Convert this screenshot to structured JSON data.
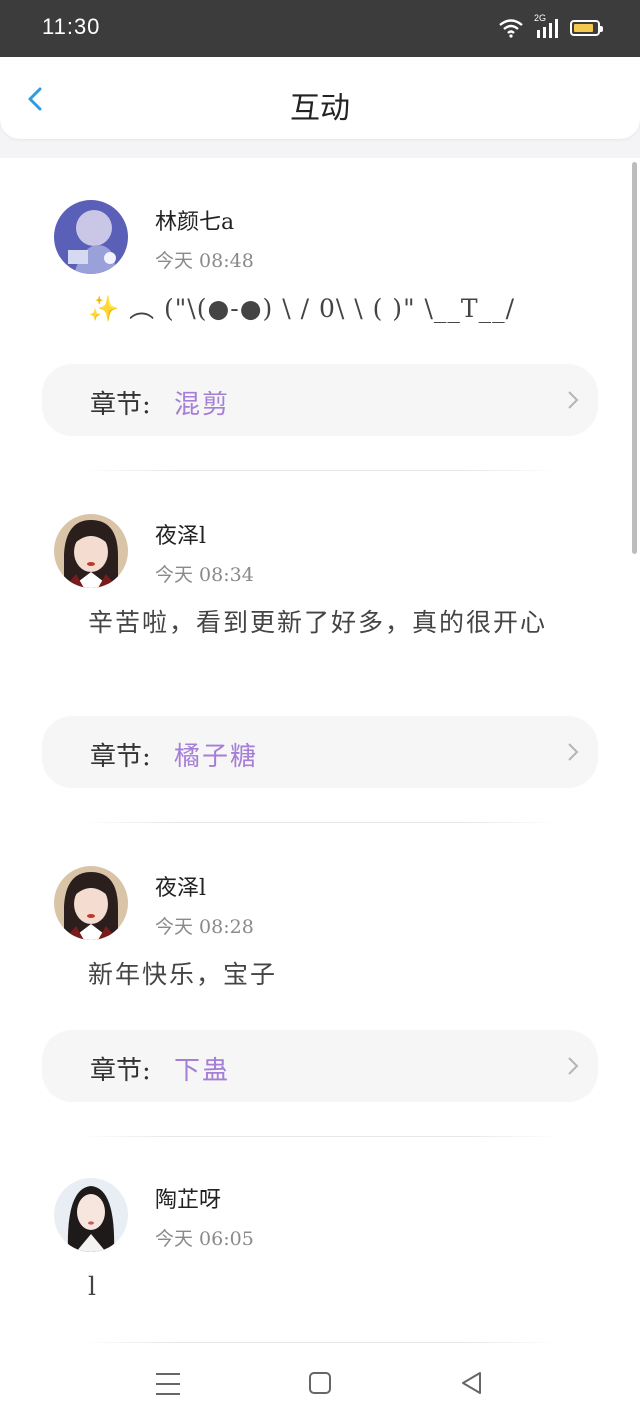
{
  "status": {
    "time": "11:30",
    "network": "2G",
    "battery_level": 0.85,
    "battery_color": "#f2c94c"
  },
  "header": {
    "title": "互动"
  },
  "colors": {
    "accent": "#a57fd6",
    "back": "#2f9be0"
  },
  "comments": [
    {
      "user": "林颜七a",
      "time": "今天 08:48",
      "text": "✨ ︵ (\"\\(●-●) \\ / 0\\ \\ ( )\" \\__T__/",
      "chapter_label": "章节:",
      "chapter": "混剪"
    },
    {
      "user": "夜泽l",
      "time": "今天 08:34",
      "text": "辛苦啦，看到更新了好多，真的很开心",
      "chapter_label": "章节:",
      "chapter": "橘子糖"
    },
    {
      "user": "夜泽l",
      "time": "今天 08:28",
      "text": "新年快乐，宝子",
      "chapter_label": "章节:",
      "chapter": "下蛊"
    },
    {
      "user": "陶芷呀",
      "time": "今天 06:05",
      "text": "l"
    }
  ],
  "navbar": {
    "icons": [
      "menu-icon",
      "home-square-icon",
      "back-triangle-icon"
    ]
  }
}
